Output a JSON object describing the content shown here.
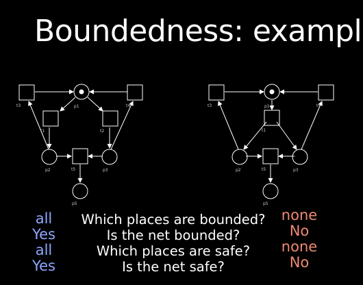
{
  "title": "Boundedness: example",
  "colors": {
    "left_answers": "#8fa8ff",
    "right_answers": "#f08a72",
    "net_stroke": "#ffffff"
  },
  "nets": [
    {
      "places": [
        {
          "id": "p1",
          "label": "p1",
          "token": true
        },
        {
          "id": "p2",
          "label": "p2",
          "token": false
        },
        {
          "id": "p3",
          "label": "p3",
          "token": false
        },
        {
          "id": "p5",
          "label": "p5",
          "token": false
        }
      ],
      "transitions": [
        {
          "id": "t3",
          "label": "t3"
        },
        {
          "id": "t4",
          "label": "t4"
        },
        {
          "id": "t1",
          "label": "t1"
        },
        {
          "id": "t2",
          "label": "t2"
        },
        {
          "id": "t5",
          "label": "t5"
        }
      ]
    },
    {
      "places": [
        {
          "id": "p1",
          "label": "p1",
          "token": true
        },
        {
          "id": "p2",
          "label": "p2",
          "token": false
        },
        {
          "id": "p3",
          "label": "p3",
          "token": false
        },
        {
          "id": "p5",
          "label": "p5",
          "token": false
        }
      ],
      "transitions": [
        {
          "id": "t3",
          "label": "t3"
        },
        {
          "id": "t4",
          "label": "t4"
        },
        {
          "id": "t1",
          "label": "t1"
        },
        {
          "id": "t5",
          "label": "t5"
        }
      ]
    }
  ],
  "questions": [
    "Which places are bounded?",
    "Is the net bounded?",
    "Which places are safe?",
    "Is the net safe?"
  ],
  "left_answers": [
    "all",
    "Yes",
    "all",
    "Yes"
  ],
  "right_answers": [
    "none",
    "No",
    "none",
    "No"
  ]
}
